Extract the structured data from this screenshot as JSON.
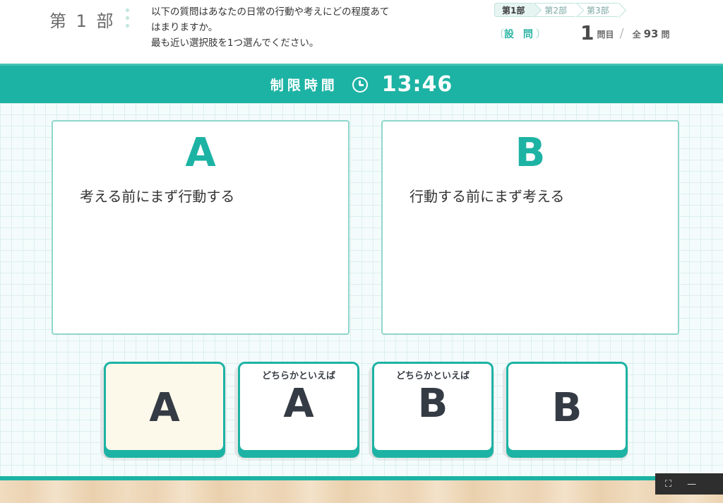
{
  "header": {
    "section_title": "第 1 部",
    "instruction_lines": [
      "以下の質問はあなたの日常の行動や考えにどの程度あて",
      "はまりますか。",
      "最も近い選択肢を1つ選んでください。"
    ],
    "steps": [
      {
        "label": "第1部",
        "active": true
      },
      {
        "label": "第2部",
        "active": false
      },
      {
        "label": "第3部",
        "active": false
      }
    ],
    "question_label": "設 問",
    "question_current": "1",
    "question_unit": "問目",
    "question_total_prefix": "全",
    "question_total": "93",
    "question_total_unit": "問"
  },
  "timer": {
    "label": "制限時間",
    "value": "13:46"
  },
  "choices": {
    "a": {
      "letter": "A",
      "text": "考える前にまず行動する"
    },
    "b": {
      "letter": "B",
      "text": "行動する前にまず考える"
    }
  },
  "answers": [
    {
      "sub": "",
      "letter": "A",
      "selected": true
    },
    {
      "sub": "どちらかといえば",
      "letter": "A",
      "selected": false
    },
    {
      "sub": "どちらかといえば",
      "letter": "B",
      "selected": false
    },
    {
      "sub": "",
      "letter": "B",
      "selected": false
    }
  ],
  "window_controls": {
    "fit_icon": "⛶",
    "minimize_icon": "—"
  },
  "colors": {
    "accent": "#1db3a4",
    "selected_bg": "#fdf9ea",
    "text_dark": "#353b44"
  }
}
